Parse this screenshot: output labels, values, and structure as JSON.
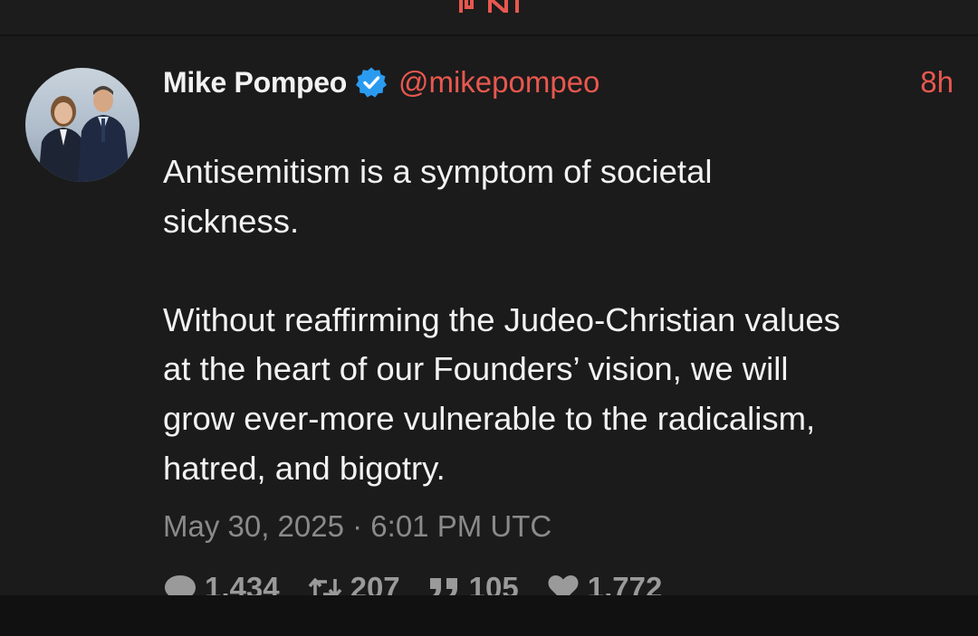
{
  "tweet": {
    "author_name": "Mike Pompeo",
    "handle": "@mikepompeo",
    "time_ago": "8h",
    "text_lines": [
      "Antisemitism is a symptom of societal",
      "sickness.",
      "",
      "Without reaffirming the Judeo-Christian values",
      "at the heart of our Founders’ vision, we will",
      "grow ever-more vulnerable to the radicalism,",
      "hatred, and bigotry."
    ],
    "date": "May 30, 2025 · 6:01 PM UTC",
    "stats": {
      "replies": "1,434",
      "retweets": "207",
      "quotes": "105",
      "likes": "1,772"
    }
  },
  "colors": {
    "accent": "#e8584f",
    "verified": "#2b9bf0",
    "text": "#f2f2f2",
    "muted": "#8a8a8a",
    "background": "#1b1b1b"
  },
  "icons": {
    "top_logo": "app-logo-icon",
    "verified": "verified-badge-icon",
    "replies": "comment-icon",
    "retweets": "retweet-icon",
    "quotes": "quote-icon",
    "likes": "heart-icon"
  }
}
